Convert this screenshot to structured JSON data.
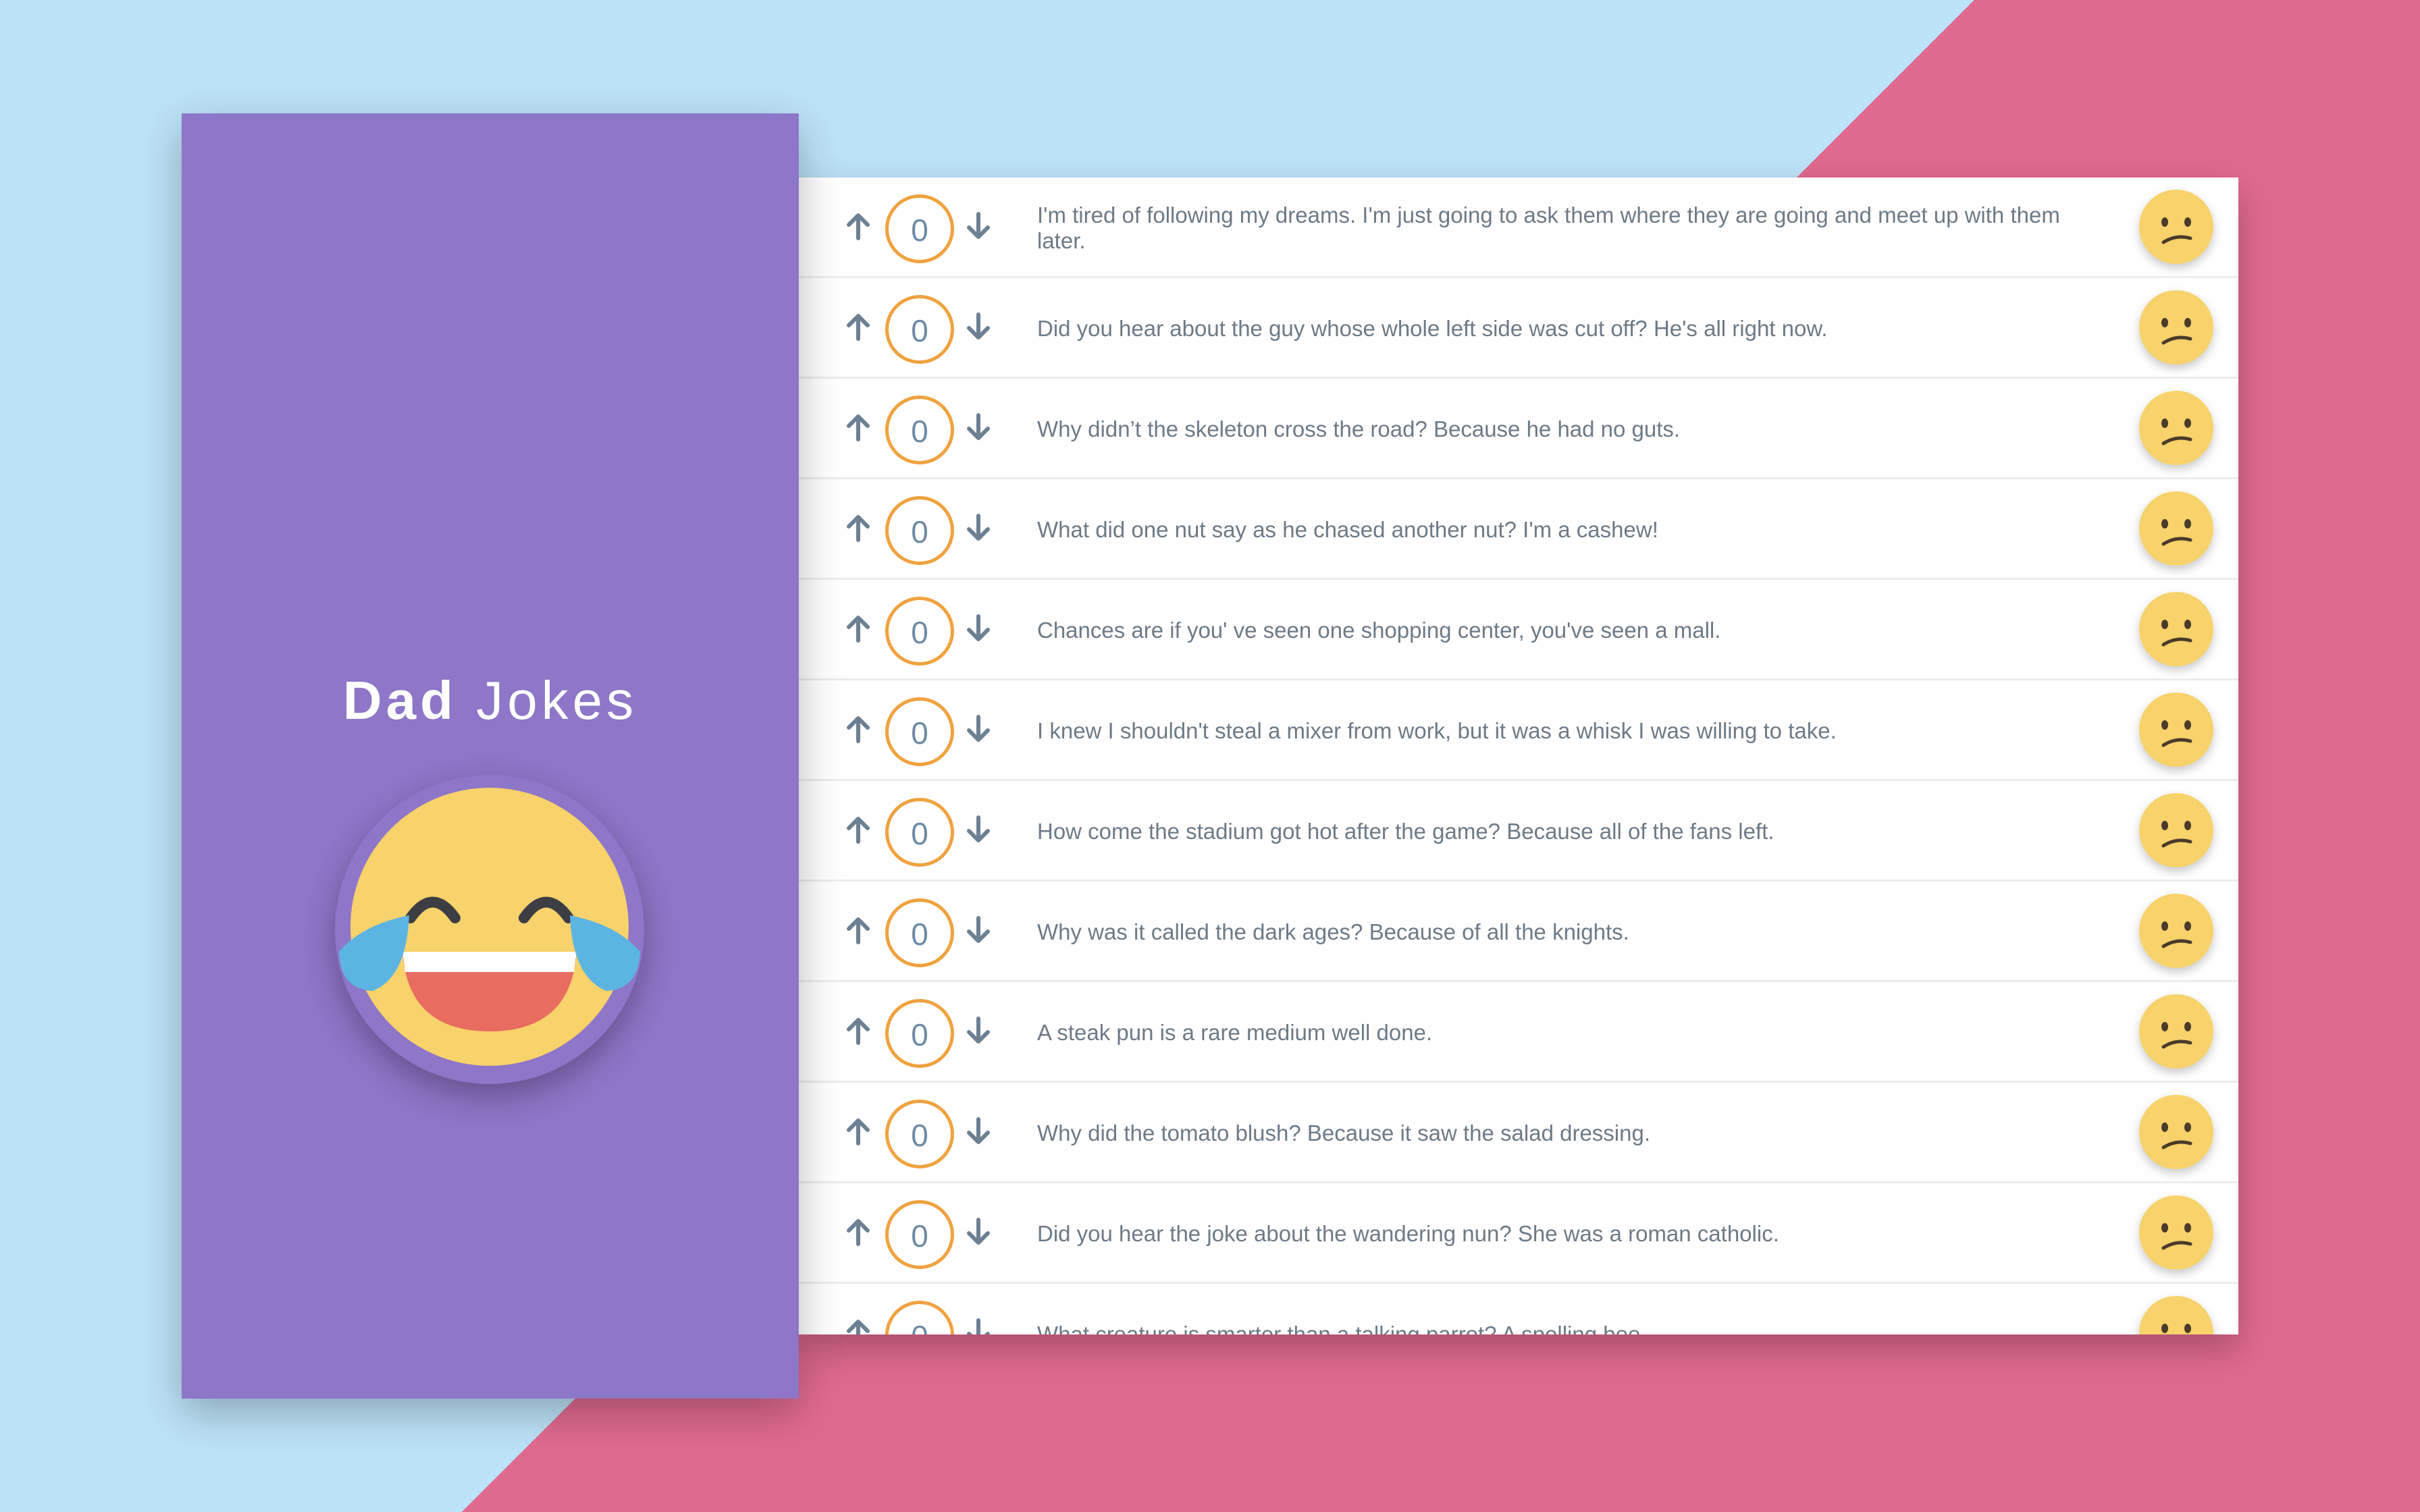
{
  "app": {
    "title_bold": "Dad",
    "title_light": "Jokes",
    "logo_icon": "laughing-tears-emoji-icon"
  },
  "colors": {
    "sidebar": "#8e76c8",
    "score_border": "#f0a23f",
    "score_text": "#6f8aa6",
    "arrow": "#6d7f93",
    "background_light": "#bde3f8",
    "background_pink": "#e06a8f",
    "face": "#f8d26a"
  },
  "jokes": [
    {
      "score": "0",
      "text": "I'm tired of following my dreams. I'm just going to ask them where they are going and meet up with them later.",
      "reaction_icon": "confused-face-icon"
    },
    {
      "score": "0",
      "text": "Did you hear about the guy whose whole left side was cut off? He's all right now.",
      "reaction_icon": "confused-face-icon"
    },
    {
      "score": "0",
      "text": "Why didn’t the skeleton cross the road? Because he had no guts.",
      "reaction_icon": "confused-face-icon"
    },
    {
      "score": "0",
      "text": "What did one nut say as he chased another nut? I'm a cashew!",
      "reaction_icon": "confused-face-icon"
    },
    {
      "score": "0",
      "text": "Chances are if you' ve seen one shopping center, you've seen a mall.",
      "reaction_icon": "confused-face-icon"
    },
    {
      "score": "0",
      "text": "I knew I shouldn't steal a mixer from work, but it was a whisk I was willing to take.",
      "reaction_icon": "confused-face-icon"
    },
    {
      "score": "0",
      "text": "How come the stadium got hot after the game? Because all of the fans left.",
      "reaction_icon": "confused-face-icon"
    },
    {
      "score": "0",
      "text": "Why was it called the dark ages? Because of all the knights.",
      "reaction_icon": "confused-face-icon"
    },
    {
      "score": "0",
      "text": "A steak pun is a rare medium well done.",
      "reaction_icon": "confused-face-icon"
    },
    {
      "score": "0",
      "text": "Why did the tomato blush? Because it saw the salad dressing.",
      "reaction_icon": "confused-face-icon"
    },
    {
      "score": "0",
      "text": "Did you hear the joke about the wandering nun? She was a roman catholic.",
      "reaction_icon": "confused-face-icon"
    },
    {
      "score": "0",
      "text": "What creature is smarter than a talking parrot? A spelling bee.",
      "reaction_icon": "confused-face-icon"
    }
  ]
}
